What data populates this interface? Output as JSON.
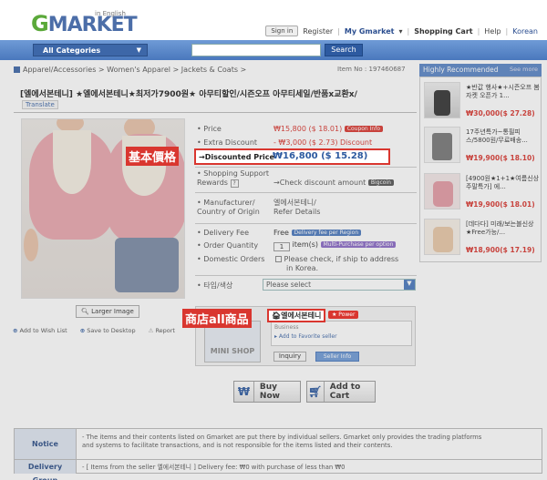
{
  "header": {
    "logo": "GMARKET",
    "logo_sub": "in English",
    "sign_in": "Sign in",
    "register": "Register",
    "my_gmarket": "My Gmarket",
    "shopping_cart": "Shopping Cart",
    "help": "Help",
    "korean": "Korean",
    "categories": "All Categories",
    "search_placeholder": "",
    "search_button": "Search"
  },
  "breadcrumb": "Apparel/Accessories > Women's Apparel > Jackets & Coats >",
  "item_no": "Item No : 197460687",
  "title": "[엘에서본테니] ★엘에서본테니★최저가7900원★ 아무티할인/시즌오프 아무티세일/반품x교환x/",
  "translate": "Translate",
  "photo": {
    "larger_image": "Larger Image",
    "wish_list": "Add to Wish List",
    "save_to_desktop": "Save to Desktop",
    "report": "Report"
  },
  "details": {
    "price_label": "Price",
    "price_value": "₩15,800 ($ 18.01)",
    "coupon_tag": "Coupon Info",
    "extra_label": "Extra Discount",
    "extra_value": "- ₩3,000 ($ 2.73) Discount",
    "discounted_label": "Discounted Price",
    "discounted_value": "₩16,800 ($ 15.28)",
    "support_label": "Shopping Support Rewards",
    "support_value": "Check discount amount",
    "support_tag": "Bigcoin",
    "manufacturer_label": "Manufacturer/ Country of Origin",
    "manufacturer_value_1": "엘에서본테니/",
    "manufacturer_value_2": "Refer Details",
    "delivery_label": "Delivery Fee",
    "delivery_value": "Free",
    "delivery_tag": "Delivery fee per Region",
    "quantity_label": "Order Quantity",
    "quantity_value": "1",
    "quantity_unit": "item(s)",
    "quantity_tag": "Multi-Purchase per option",
    "domestic_label": "Domestic Orders",
    "domestic_value_1": "Please check, if ship to address",
    "domestic_value_2": "in Korea.",
    "option_label": "타입/색상",
    "option_value": "Please select"
  },
  "seller": {
    "mini_shop": "MINI SHOP",
    "name": "엘에서본테니",
    "power": "Power",
    "business": "Business",
    "add_favorite": "Add to Favorite seller",
    "inquiry": "Inquiry",
    "seller_info": "Seller Info"
  },
  "buttons": {
    "buy_now": "Buy Now",
    "add_to_cart": "Add to Cart"
  },
  "annotations": {
    "base_price": "基本價格",
    "shop_all": "商店all商品"
  },
  "recommended": {
    "title": "Highly Recommended",
    "more": "See more",
    "items": [
      {
        "name": "★반값 행사★+시즌오프 봄 자켓 오픈가 1...",
        "price": "₩30,000($ 27.28)"
      },
      {
        "name": "17주년특가~통필피스/5800원/무료배송...",
        "price": "₩19,900($ 18.10)"
      },
      {
        "name": "[4900원★1+1★여름신상 주말특가] 에...",
        "price": "₩19,900($ 18.01)"
      },
      {
        "name": "[데다다] 미래/보는블신상★Free가능/...",
        "price": "₩18,900($ 17.19)"
      }
    ]
  },
  "notice": {
    "label": "Notice",
    "text_1": "- The items and their contents listed on Gmarket are put there by individual sellers. Gmarket only provides the trading platforms",
    "text_2": "and systems to facilitate transactions, and is not responsible for the items listed and their contents.",
    "delivery_label": "Delivery Group",
    "delivery_text": "- [ Items from the seller 엘에서본테니 ] Delivery fee: ₩0 with purchase of less than ₩0"
  }
}
